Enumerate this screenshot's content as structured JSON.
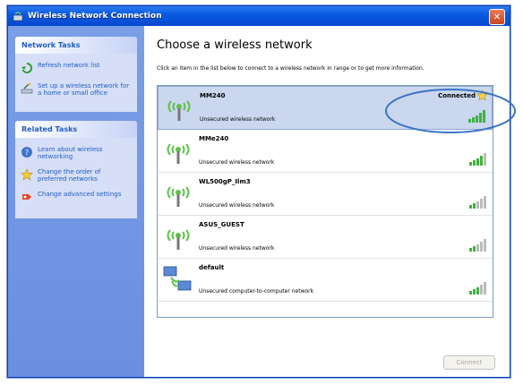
{
  "window": {
    "title": "Wireless Network Connection"
  },
  "sidebar": {
    "network_tasks": {
      "title": "Network Tasks",
      "items": [
        {
          "label": "Refresh network list",
          "icon": "refresh-icon"
        },
        {
          "label": "Set up a wireless network for a home or small office",
          "icon": "setup-wizard-icon"
        }
      ]
    },
    "related_tasks": {
      "title": "Related Tasks",
      "items": [
        {
          "label": "Learn about wireless networking",
          "icon": "help-icon"
        },
        {
          "label": "Change the order of preferred networks",
          "icon": "star-icon"
        },
        {
          "label": "Change advanced settings",
          "icon": "settings-icon"
        }
      ]
    }
  },
  "main": {
    "heading": "Choose a wireless network",
    "instructions": "Click an item in the list below to connect to a wireless network in range or to get more information.",
    "networks": [
      {
        "name": "MM240",
        "description": "Unsecured wireless network",
        "status": "Connected",
        "selected": true,
        "icon": "wireless-antenna-icon"
      },
      {
        "name": "MMe240",
        "description": "Unsecured wireless network",
        "status": "",
        "icon": "wireless-antenna-icon"
      },
      {
        "name": "WL500gP_Ilm3",
        "description": "Unsecured wireless network",
        "status": "",
        "icon": "wireless-antenna-icon"
      },
      {
        "name": "ASUS_GUEST",
        "description": "Unsecured wireless network",
        "status": "",
        "icon": "wireless-antenna-icon"
      },
      {
        "name": "default",
        "description": "Unsecured computer-to-computer network",
        "status": "",
        "icon": "computer-to-computer-icon"
      }
    ],
    "connect_label": "Connect"
  },
  "colors": {
    "titlebar": "#0a5ae3",
    "sidebar": "#6b8ee0",
    "link": "#215dc6",
    "selected_row": "#cad7ee",
    "annotation_oval": "#3a74c4"
  }
}
